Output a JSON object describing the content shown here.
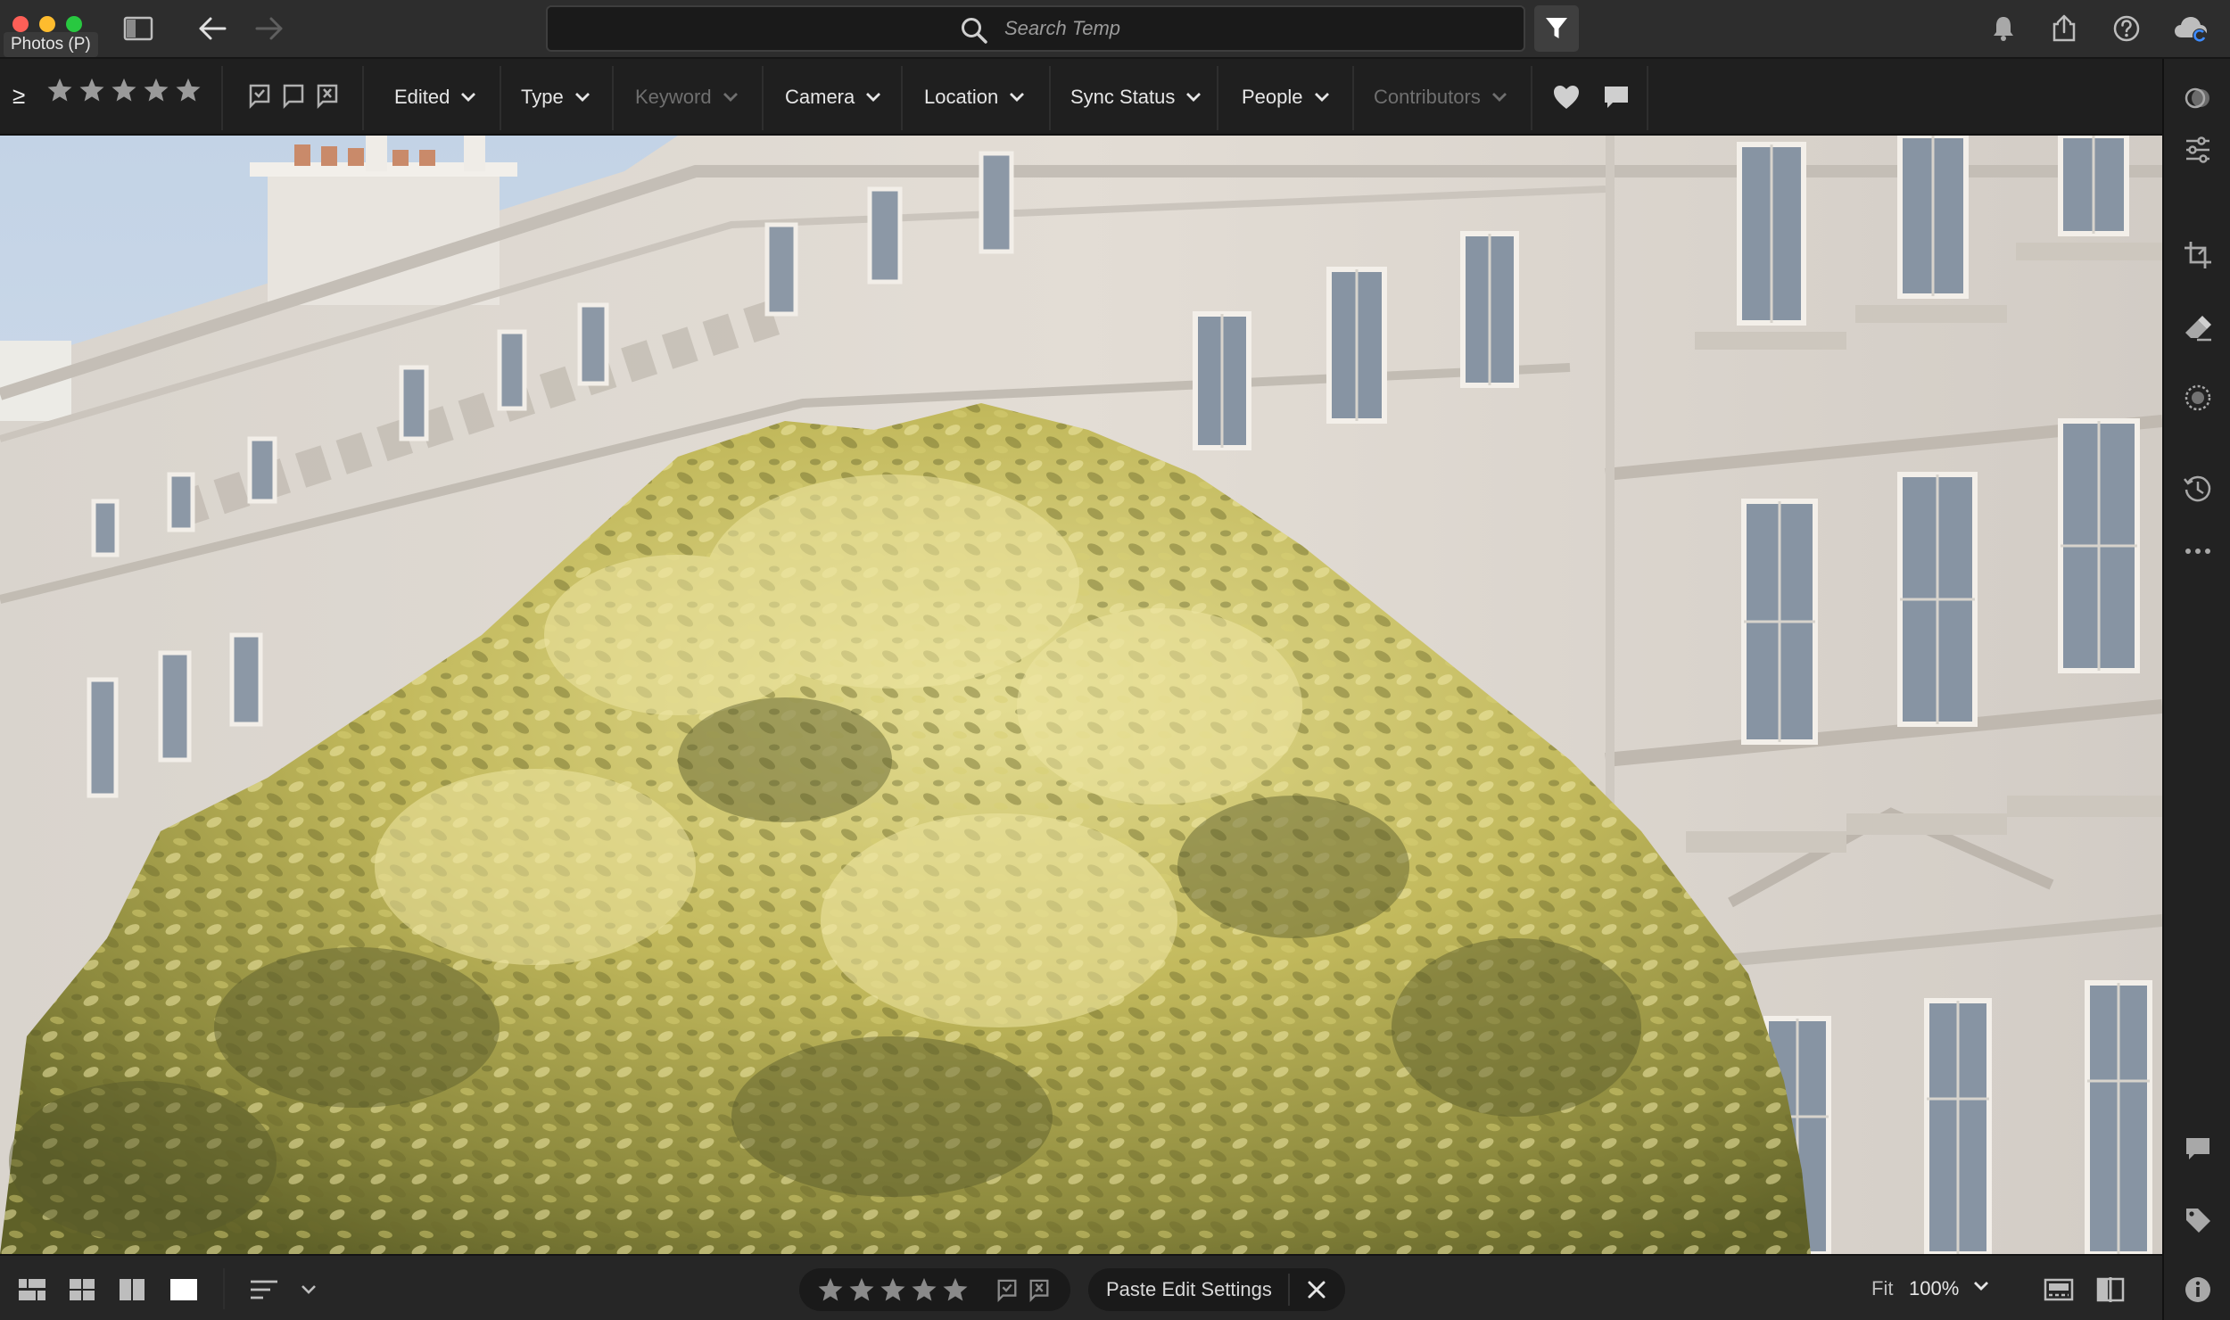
{
  "app": {
    "name": "Photos (P)"
  },
  "search": {
    "placeholder": "Search Temp",
    "value": ""
  },
  "filterbar": {
    "rating_operator": "≥",
    "dropdowns": [
      {
        "label": "Edited",
        "enabled": true
      },
      {
        "label": "Type",
        "enabled": true
      },
      {
        "label": "Keyword",
        "enabled": false
      },
      {
        "label": "Camera",
        "enabled": true
      },
      {
        "label": "Location",
        "enabled": true
      },
      {
        "label": "Sync Status",
        "enabled": true
      },
      {
        "label": "People",
        "enabled": true
      },
      {
        "label": "Contributors",
        "enabled": false
      }
    ]
  },
  "photo": {
    "subject": "tree-in-front-of-building"
  },
  "bottombar": {
    "paste_label": "Paste Edit Settings",
    "zoom_fit_label": "Fit",
    "zoom_level": "100%"
  },
  "colors": {
    "titlebar_bg": "#2d2d2d",
    "filterbar_bg": "#1f1f1f",
    "text": "#e6e6e6",
    "disabled_text": "#6f6f6f",
    "icon": "#bdbdbd",
    "sky": "#c9d7e6",
    "facade": "#dcd6cf",
    "foliage": "#b9b35a"
  }
}
